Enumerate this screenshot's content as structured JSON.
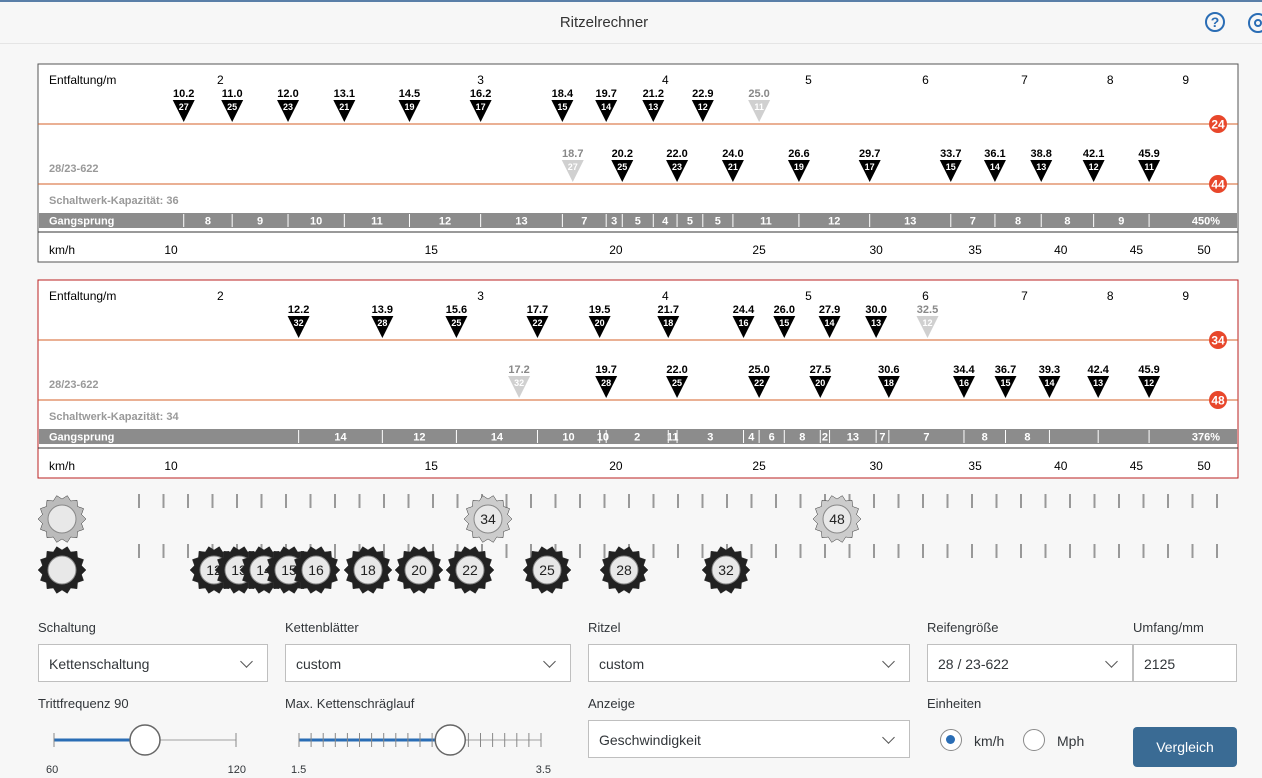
{
  "app": {
    "title": "Ritzelrechner"
  },
  "icons": {
    "help": "help-icon",
    "settings": "gear-icon"
  },
  "colors": {
    "accent": "#2a6db5",
    "chainring_badge": "#e8472b",
    "gangsprung_bar": "#8c8c8c",
    "button": "#3a6b94"
  },
  "panels": [
    {
      "entfaltung_label": "Entfaltung/m",
      "entfaltung_ticks": [
        2,
        3,
        4,
        5,
        6,
        7,
        8,
        9
      ],
      "tire_label": "28/23-622",
      "capacity_label": "Schaltwerk-Kapazität: 36",
      "gangsprung_label": "Gangsprung",
      "gangsprung_values": [
        "8",
        "9",
        "10",
        "11",
        "12",
        "13",
        "7",
        "3",
        "5",
        "4",
        "5",
        "5",
        "11",
        "12",
        "13",
        "7",
        "8",
        "8",
        "9",
        "450%"
      ],
      "speed_label": "km/h",
      "speed_ticks": [
        10,
        15,
        20,
        25,
        30,
        35,
        40,
        45,
        50
      ],
      "chainrings": [
        {
          "teeth": "24",
          "gears": [
            {
              "speed": 10.2,
              "value": "10.2",
              "cog": "27",
              "dim": false
            },
            {
              "speed": 11.0,
              "value": "11.0",
              "cog": "25",
              "dim": false
            },
            {
              "speed": 12.0,
              "value": "12.0",
              "cog": "23",
              "dim": false
            },
            {
              "speed": 13.1,
              "value": "13.1",
              "cog": "21",
              "dim": false
            },
            {
              "speed": 14.5,
              "value": "14.5",
              "cog": "19",
              "dim": false
            },
            {
              "speed": 16.2,
              "value": "16.2",
              "cog": "17",
              "dim": false
            },
            {
              "speed": 18.4,
              "value": "18.4",
              "cog": "15",
              "dim": false
            },
            {
              "speed": 19.7,
              "value": "19.7",
              "cog": "14",
              "dim": false
            },
            {
              "speed": 21.2,
              "value": "21.2",
              "cog": "13",
              "dim": false
            },
            {
              "speed": 22.9,
              "value": "22.9",
              "cog": "12",
              "dim": false
            },
            {
              "speed": 25.0,
              "value": "25.0",
              "cog": "11",
              "dim": true
            }
          ]
        },
        {
          "teeth": "44",
          "gears": [
            {
              "speed": 18.7,
              "value": "18.7",
              "cog": "27",
              "dim": true
            },
            {
              "speed": 20.2,
              "value": "20.2",
              "cog": "25",
              "dim": false
            },
            {
              "speed": 22.0,
              "value": "22.0",
              "cog": "23",
              "dim": false
            },
            {
              "speed": 24.0,
              "value": "24.0",
              "cog": "21",
              "dim": false
            },
            {
              "speed": 26.6,
              "value": "26.6",
              "cog": "19",
              "dim": false
            },
            {
              "speed": 29.7,
              "value": "29.7",
              "cog": "17",
              "dim": false
            },
            {
              "speed": 33.7,
              "value": "33.7",
              "cog": "15",
              "dim": false
            },
            {
              "speed": 36.1,
              "value": "36.1",
              "cog": "14",
              "dim": false
            },
            {
              "speed": 38.8,
              "value": "38.8",
              "cog": "13",
              "dim": false
            },
            {
              "speed": 42.1,
              "value": "42.1",
              "cog": "12",
              "dim": false
            },
            {
              "speed": 45.9,
              "value": "45.9",
              "cog": "11",
              "dim": false
            }
          ]
        }
      ]
    },
    {
      "entfaltung_label": "Entfaltung/m",
      "entfaltung_ticks": [
        2,
        3,
        4,
        5,
        6,
        7,
        8,
        9
      ],
      "tire_label": "28/23-622",
      "capacity_label": "Schaltwerk-Kapazität: 34",
      "gangsprung_label": "Gangsprung",
      "gangsprung_values": [
        "14",
        "12",
        "14",
        "10",
        "10",
        "2",
        "11",
        "3",
        "4",
        "6",
        "8",
        "2",
        "13",
        "7",
        "7",
        "8",
        "8",
        "376%"
      ],
      "speed_label": "km/h",
      "speed_ticks": [
        10,
        15,
        20,
        25,
        30,
        35,
        40,
        45,
        50
      ],
      "chainrings": [
        {
          "teeth": "34",
          "gears": [
            {
              "speed": 12.2,
              "value": "12.2",
              "cog": "32",
              "dim": false
            },
            {
              "speed": 13.9,
              "value": "13.9",
              "cog": "28",
              "dim": false
            },
            {
              "speed": 15.6,
              "value": "15.6",
              "cog": "25",
              "dim": false
            },
            {
              "speed": 17.7,
              "value": "17.7",
              "cog": "22",
              "dim": false
            },
            {
              "speed": 19.5,
              "value": "19.5",
              "cog": "20",
              "dim": false
            },
            {
              "speed": 21.7,
              "value": "21.7",
              "cog": "18",
              "dim": false
            },
            {
              "speed": 24.4,
              "value": "24.4",
              "cog": "16",
              "dim": false
            },
            {
              "speed": 26.0,
              "value": "26.0",
              "cog": "15",
              "dim": false
            },
            {
              "speed": 27.9,
              "value": "27.9",
              "cog": "14",
              "dim": false
            },
            {
              "speed": 30.0,
              "value": "30.0",
              "cog": "13",
              "dim": false
            },
            {
              "speed": 32.5,
              "value": "32.5",
              "cog": "12",
              "dim": true
            }
          ]
        },
        {
          "teeth": "48",
          "gears": [
            {
              "speed": 17.2,
              "value": "17.2",
              "cog": "32",
              "dim": true
            },
            {
              "speed": 19.7,
              "value": "19.7",
              "cog": "28",
              "dim": false
            },
            {
              "speed": 22.0,
              "value": "22.0",
              "cog": "25",
              "dim": false
            },
            {
              "speed": 25.0,
              "value": "25.0",
              "cog": "22",
              "dim": false
            },
            {
              "speed": 27.5,
              "value": "27.5",
              "cog": "20",
              "dim": false
            },
            {
              "speed": 30.6,
              "value": "30.6",
              "cog": "18",
              "dim": false
            },
            {
              "speed": 34.4,
              "value": "34.4",
              "cog": "16",
              "dim": false
            },
            {
              "speed": 36.7,
              "value": "36.7",
              "cog": "15",
              "dim": false
            },
            {
              "speed": 39.3,
              "value": "39.3",
              "cog": "14",
              "dim": false
            },
            {
              "speed": 42.4,
              "value": "42.4",
              "cog": "13",
              "dim": false
            },
            {
              "speed": 45.9,
              "value": "45.9",
              "cog": "12",
              "dim": false
            }
          ]
        }
      ]
    }
  ],
  "drivetrain": {
    "chainrings": [
      "34",
      "48"
    ],
    "cogs": [
      "12",
      "13",
      "14",
      "15",
      "16",
      "18",
      "20",
      "22",
      "25",
      "28",
      "32"
    ]
  },
  "controls": {
    "schaltung": {
      "label": "Schaltung",
      "value": "Kettenschaltung"
    },
    "kettenblaetter": {
      "label": "Kettenblätter",
      "value": "custom"
    },
    "ritzel": {
      "label": "Ritzel",
      "value": "custom"
    },
    "reifengroesse": {
      "label": "Reifengröße",
      "value": "28 / 23-622"
    },
    "umfang": {
      "label": "Umfang/mm",
      "value": "2125"
    },
    "trittfrequenz": {
      "label": "Trittfrequenz 90",
      "min": "60",
      "max": "120",
      "value": 90,
      "min_value": 60,
      "max_value": 120
    },
    "kettenschraeglauf": {
      "label": "Max. Kettenschräglauf",
      "min": "1.5",
      "max": "3.5",
      "value": 2.75,
      "min_value": 1.5,
      "max_value": 3.5
    },
    "anzeige": {
      "label": "Anzeige",
      "value": "Geschwindigkeit"
    },
    "einheiten": {
      "label": "Einheiten",
      "option_kmh": "km/h",
      "option_mph": "Mph",
      "selected": "km/h"
    },
    "vergleich_button": "Vergleich"
  }
}
